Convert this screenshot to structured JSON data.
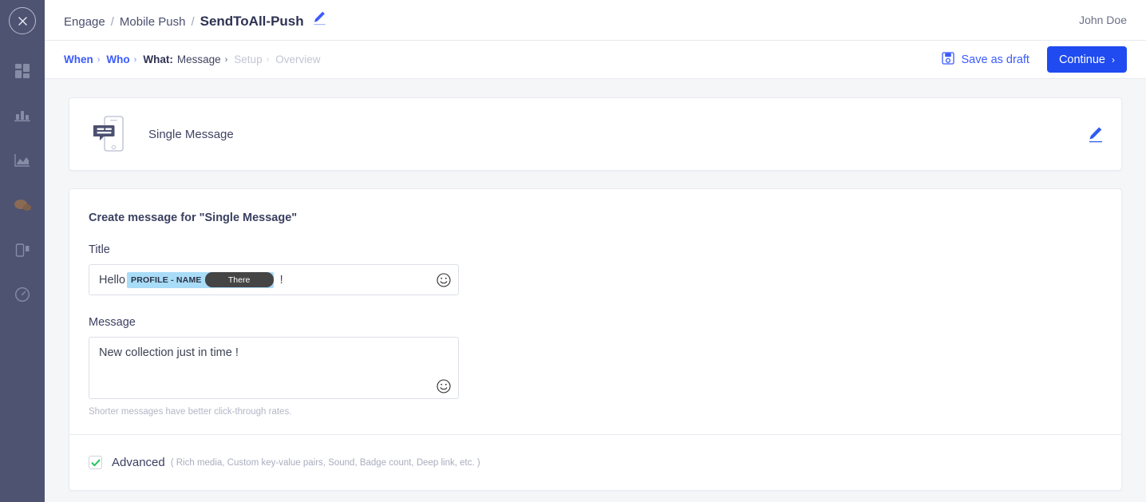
{
  "sidebar": {
    "close_label": "Close",
    "items": [
      {
        "name": "dashboard",
        "icon": "grid-icon",
        "active": false
      },
      {
        "name": "analytics",
        "icon": "bar-chart-icon",
        "active": false
      },
      {
        "name": "reports",
        "icon": "area-chart-icon",
        "active": false
      },
      {
        "name": "engage",
        "icon": "chat-bubbles-icon",
        "active": true
      },
      {
        "name": "content",
        "icon": "mobile-content-icon",
        "active": false
      },
      {
        "name": "performance",
        "icon": "gauge-icon",
        "active": false
      }
    ]
  },
  "topbar": {
    "breadcrumb": [
      {
        "label": "Engage",
        "current": false
      },
      {
        "label": "Mobile Push",
        "current": false
      },
      {
        "label": "SendToAll-Push",
        "current": true
      }
    ],
    "separator": "/",
    "edit_title_icon": "pencil-icon",
    "user": "John Doe"
  },
  "steps": {
    "items": [
      {
        "label": "When",
        "sub": "",
        "state": "done",
        "chevron": "›"
      },
      {
        "label": "Who",
        "sub": "",
        "state": "done",
        "chevron": "›"
      },
      {
        "label": "What:",
        "sub": "Message",
        "state": "current",
        "chevron": "›"
      },
      {
        "label": "Setup",
        "sub": "",
        "state": "disabled",
        "chevron": "›"
      },
      {
        "label": "Overview",
        "sub": "",
        "state": "disabled",
        "chevron": ""
      }
    ],
    "save_draft_label": "Save as draft",
    "save_draft_icon": "floppy-disk-icon",
    "continue_label": "Continue",
    "continue_chevron": "›",
    "accent_color": "#1f4bf0",
    "link_color": "#3b5bfd"
  },
  "message_type_card": {
    "icon": "phone-message-icon",
    "label": "Single Message",
    "edit_icon": "pencil-icon"
  },
  "form": {
    "heading": "Create message for \"Single Message\"",
    "title": {
      "label": "Title",
      "prefix_text": "Hello",
      "token_key": "PROFILE - NAME",
      "token_value": "There",
      "suffix_text": "!",
      "emoji_icon": "smiley-icon",
      "token_bg": "#a9dcf7",
      "token_value_bg": "#454545"
    },
    "message": {
      "label": "Message",
      "value": "New collection just in time !",
      "emoji_icon": "smiley-icon",
      "hint": "Shorter messages have better click-through rates."
    },
    "advanced": {
      "checked": true,
      "label": "Advanced",
      "hint": "( Rich media, Custom key-value pairs, Sound, Badge count, Deep link, etc. )",
      "check_color": "#22c55e"
    }
  }
}
